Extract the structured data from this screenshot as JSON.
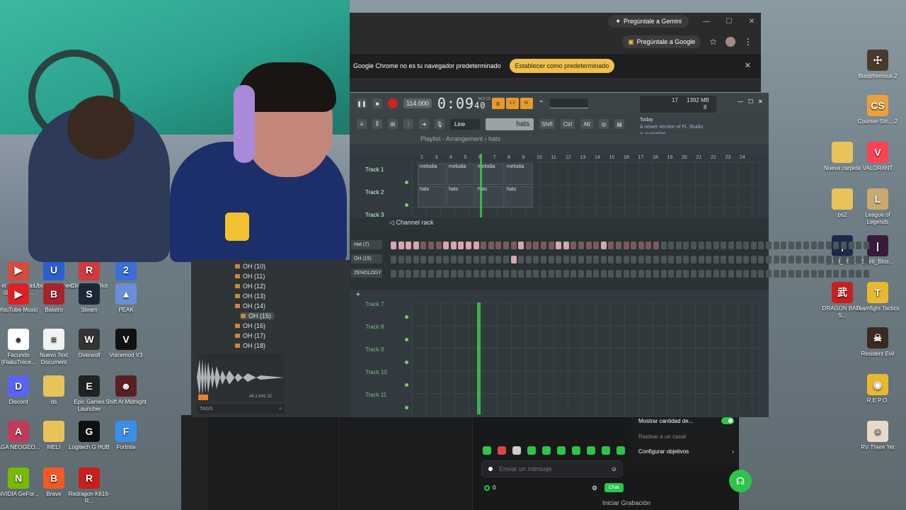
{
  "desktop": {
    "icons_left": [
      {
        "label": "el país de las últimas co...",
        "color": "#d84a3a",
        "glyph": "▶"
      },
      {
        "label": "Ubisoft Connect",
        "color": "#2a5fd0",
        "glyph": "U"
      },
      {
        "label": "Cliente de Riot",
        "color": "#d13a3a",
        "glyph": "R"
      },
      {
        "label": "PCSX2",
        "color": "#3a6fd8",
        "glyph": "2"
      },
      {
        "label": "YouTube Music",
        "color": "#e02020",
        "glyph": "▶"
      },
      {
        "label": "Balatro",
        "color": "#a8242c",
        "glyph": "B"
      },
      {
        "label": "Steam",
        "color": "#1b2838",
        "glyph": "S"
      },
      {
        "label": "PEAK",
        "color": "#6a8fd8",
        "glyph": "▲"
      },
      {
        "label": "Facundo (FlakuTrece...",
        "color": "#ffffff",
        "glyph": "●"
      },
      {
        "label": "Nuevo Text Document",
        "color": "#f2f2f2",
        "glyph": "≡"
      },
      {
        "label": "Overwolf",
        "color": "#333333",
        "glyph": "W"
      },
      {
        "label": "Voicemod V3",
        "color": "#121212",
        "glyph": "V"
      },
      {
        "label": "Discord",
        "color": "#5865f2",
        "glyph": "D"
      },
      {
        "label": "ds",
        "color": "#e8c35a",
        "glyph": ""
      },
      {
        "label": "Epic Games Launcher",
        "color": "#222222",
        "glyph": "E"
      },
      {
        "label": "Shift At Midnight",
        "color": "#5a2020",
        "glyph": "☻"
      },
      {
        "label": "AGA NEOGEO...",
        "color": "#c23a5a",
        "glyph": "A"
      },
      {
        "label": "MELI",
        "color": "#e8c35a",
        "glyph": ""
      },
      {
        "label": "Logitech G HUB",
        "color": "#101010",
        "glyph": "G"
      },
      {
        "label": "Fortnite",
        "color": "#3a8fe8",
        "glyph": "F"
      },
      {
        "label": "NVIDIA GeFor...",
        "color": "#76b900",
        "glyph": "N"
      },
      {
        "label": "Brave",
        "color": "#f15a22",
        "glyph": "B"
      },
      {
        "label": "Redragon K616-R...",
        "color": "#c81e1e",
        "glyph": "R"
      }
    ],
    "icons_right": [
      {
        "label": "Blasphemous 2",
        "color": "#4a3a2a",
        "glyph": "☩"
      },
      {
        "label": "Counter-Stri... 2",
        "color": "#e8a23a",
        "glyph": "CS"
      },
      {
        "label": "Nueva carpeta",
        "color": "#e8c35a",
        "glyph": ""
      },
      {
        "label": "VALORANT",
        "color": "#fa4454",
        "glyph": "V"
      },
      {
        "label": "ps2",
        "color": "#e8c35a",
        "glyph": ""
      },
      {
        "label": "League of Legends",
        "color": "#c8aa6e",
        "glyph": "L"
      },
      {
        "label": "Sinful_Shor...",
        "color": "#1a2a4a",
        "glyph": "|"
      },
      {
        "label": "Spirit_Blos...",
        "color": "#3a1a3a",
        "glyph": "|"
      },
      {
        "label": "DRAGON BALL S...",
        "color": "#c82020",
        "glyph": "武"
      },
      {
        "label": "Teamfight Tactics",
        "color": "#e8b830",
        "glyph": "T"
      },
      {
        "label": "Resident Evil",
        "color": "#3a2a20",
        "glyph": "☠"
      },
      {
        "label": "R.E.P.O.",
        "color": "#e8b830",
        "glyph": "◉"
      },
      {
        "label": "RV There Yet",
        "color": "#e8d8c8",
        "glyph": "☺"
      }
    ]
  },
  "chrome": {
    "gemini_button": "Pregúntale a Gemini",
    "google_button": "Pregúntale a Google",
    "infobar_text": "Google Chrome no es tu navegador predeterminado",
    "set_default_button": "Establecer como predeterminado",
    "close_glyph": "✕",
    "minimize_glyph": "—",
    "maximize_glyph": "☐",
    "star_glyph": "☆",
    "menu_glyph": "⋮"
  },
  "fl_studio": {
    "tempo": "114.000",
    "clock": "0:09",
    "clock_small": "40",
    "clock_unit": "M:S:CS",
    "cpu_label": "17",
    "mem": "1392 MB",
    "poly": "8",
    "snap": "Line",
    "pattern": "hats",
    "news_today": "Today",
    "news_text": "A newer version of FL Studio is available!",
    "modifier_keys": [
      "Shift",
      "Ctrl",
      "Alt"
    ],
    "playlist_title": "Playlist - Arrangement",
    "playlist_pattern": "hats",
    "ruler": [
      "2",
      "3",
      "4",
      "5",
      "6",
      "7",
      "8",
      "9",
      "10",
      "11",
      "12",
      "13",
      "14",
      "15",
      "16",
      "17",
      "18",
      "19",
      "20",
      "21",
      "22",
      "23",
      "24"
    ],
    "tracks": [
      {
        "label": "Track 1",
        "clips": [
          "melodia",
          "melodia",
          "melodia",
          "melodia"
        ]
      },
      {
        "label": "Track 2",
        "clips": [
          "hats",
          "hats",
          "hats",
          "hats"
        ]
      },
      {
        "label": "Track 3"
      }
    ],
    "lower_tracks": [
      "Track 7",
      "Track 8",
      "Track 9",
      "Track 10",
      "Track 11"
    ],
    "channel_rack_title": "Channel rack",
    "channels": [
      {
        "name": "Hat (7)",
        "steps": [
          1,
          1,
          1,
          1,
          2,
          2,
          2,
          1,
          1,
          1,
          1,
          1,
          2,
          2,
          2,
          2,
          2,
          1,
          2,
          2,
          2,
          2,
          1,
          1,
          2,
          2,
          2,
          2,
          1,
          2,
          2,
          2,
          2,
          2,
          2,
          2,
          0,
          0,
          0,
          0,
          0,
          0,
          0,
          0,
          0,
          0,
          0,
          0,
          0,
          0,
          0,
          0,
          0,
          0,
          0,
          0,
          0,
          0,
          0,
          0,
          0,
          0,
          0,
          0
        ]
      },
      {
        "name": "OH (15)",
        "steps": [
          0,
          0,
          0,
          0,
          0,
          0,
          0,
          0,
          0,
          0,
          0,
          0,
          0,
          0,
          0,
          0,
          2,
          0,
          0,
          0,
          0,
          0,
          0,
          0,
          0,
          0,
          0,
          0,
          0,
          0,
          0,
          0,
          0,
          0,
          0,
          0,
          0,
          0,
          0,
          0,
          0,
          0,
          0,
          0,
          0,
          0,
          0,
          0,
          0,
          0,
          0,
          0,
          0,
          0,
          0,
          0,
          0,
          0,
          0,
          0,
          0,
          0,
          0,
          0
        ]
      },
      {
        "name": "ZENOLOGY",
        "steps": [
          0,
          0,
          0,
          0,
          0,
          0,
          0,
          0,
          0,
          0,
          0,
          0,
          0,
          0,
          0,
          0,
          0,
          0,
          0,
          0,
          0,
          0,
          0,
          0,
          0,
          0,
          0,
          0,
          0,
          0,
          0,
          0,
          0,
          0,
          0,
          0,
          0,
          0,
          0,
          0,
          0,
          0,
          0,
          0,
          0,
          0,
          0,
          0,
          0,
          0,
          0,
          0,
          0,
          0,
          0,
          0,
          0,
          0,
          0,
          0,
          0,
          0,
          0,
          0
        ]
      }
    ],
    "browser_items": [
      "OH (10)",
      "OH (11)",
      "OH (12)",
      "OH (13)",
      "OH (14)",
      "OH (15)",
      "OH (16)",
      "OH (17)",
      "OH (18)"
    ],
    "browser_selected": "OH (15)",
    "wave_info": "44.1 kHz 32",
    "tags_label": "TAGS",
    "add_glyph": "+"
  },
  "stream": {
    "message_placeholder": "Enviar un mensaje",
    "points": "0",
    "chat_button": "Chat",
    "show_count_label": "Mostrar cantidad de...",
    "raid_label": "Raidear a un canal",
    "goals_label": "Configurar objetivos",
    "start_recording": "Iniciar Grabación"
  }
}
